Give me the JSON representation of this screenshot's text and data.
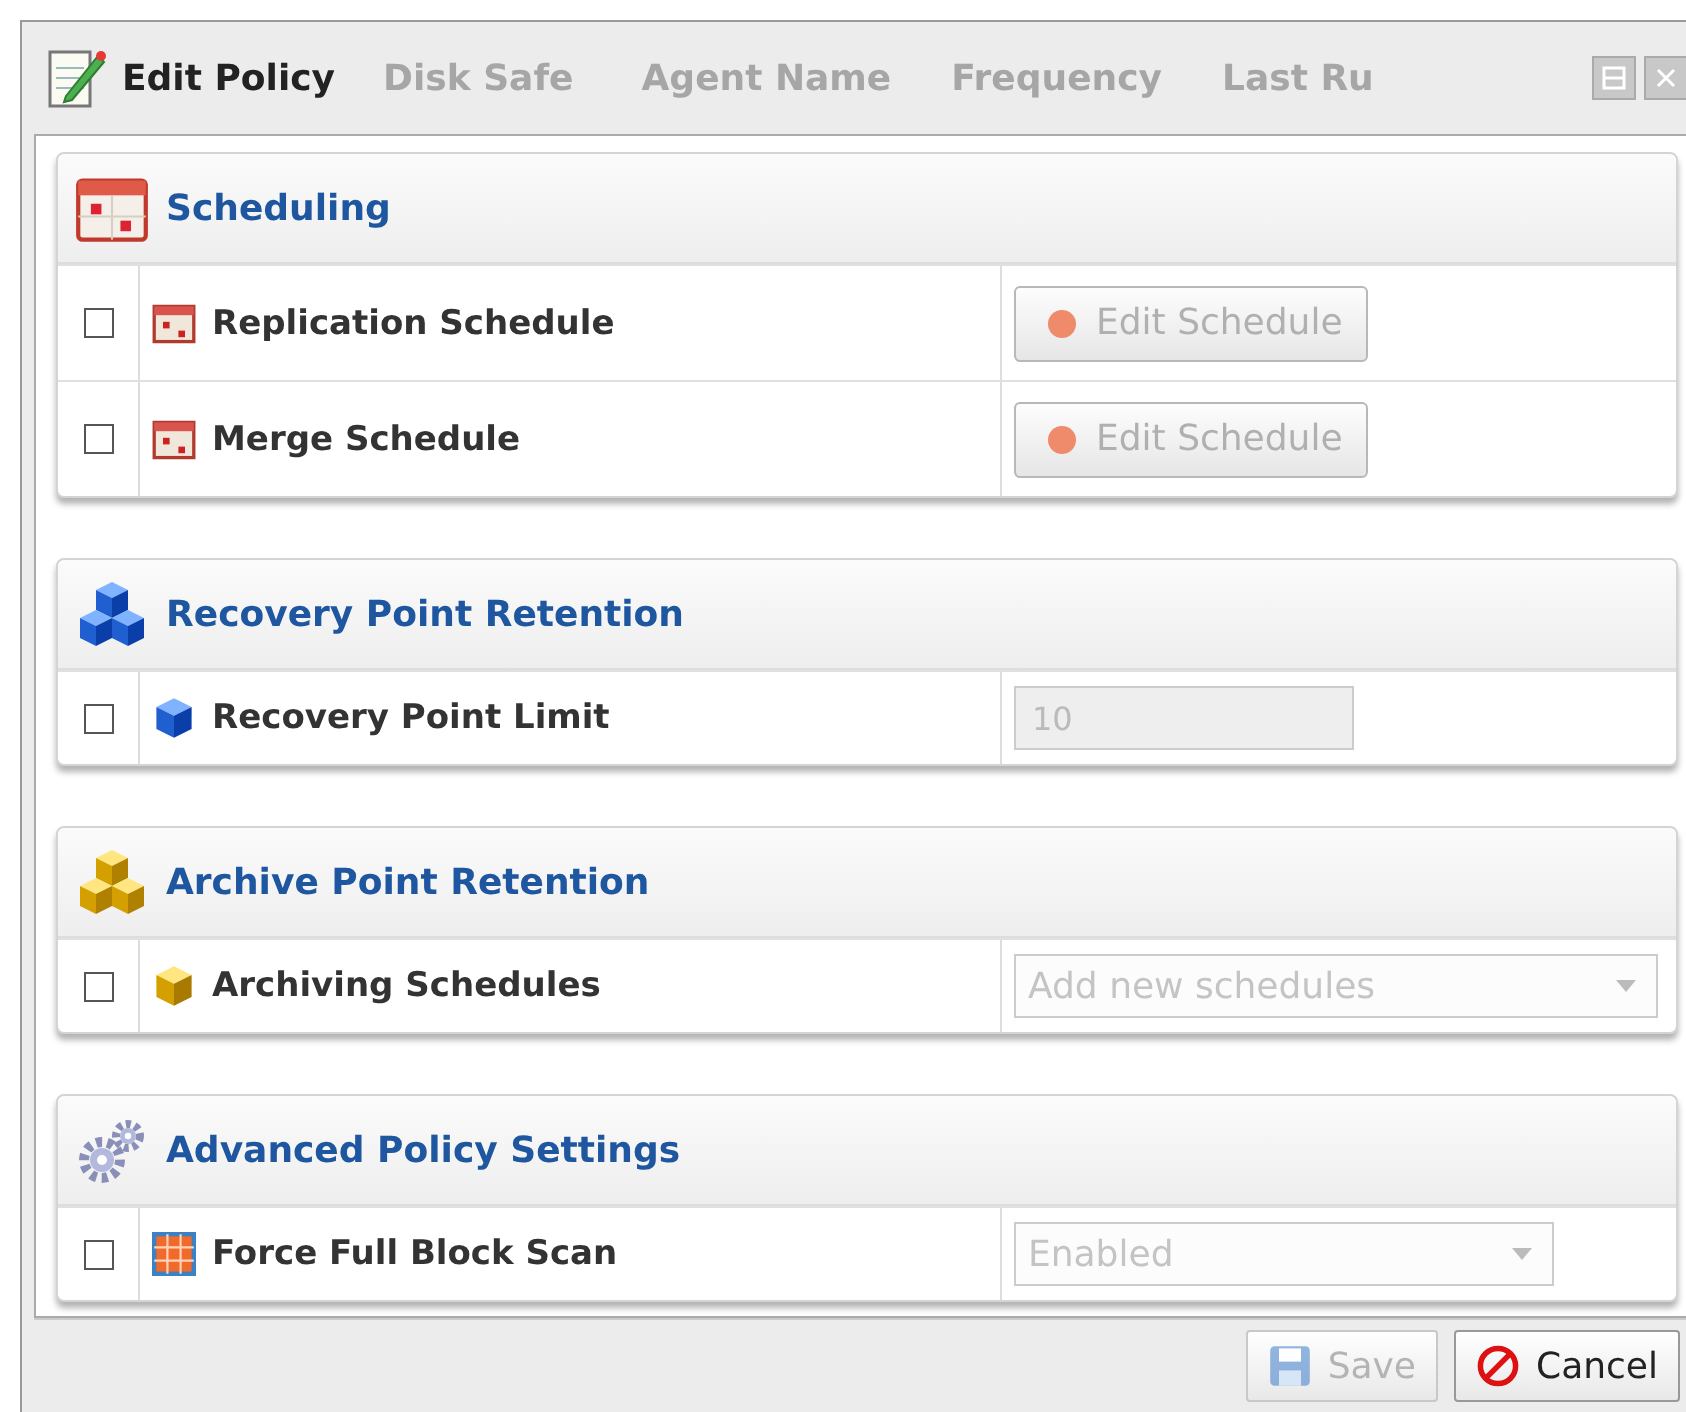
{
  "window": {
    "title": "Edit Policy"
  },
  "background_columns": [
    {
      "label": "Disk Safe"
    },
    {
      "label": "Agent Name"
    },
    {
      "label": "Frequency"
    },
    {
      "label": "Last Ru"
    }
  ],
  "sections": [
    {
      "title": "Scheduling",
      "rows": [
        {
          "label": "Replication Schedule",
          "checked": false,
          "control": {
            "kind": "button",
            "text": "Edit Schedule",
            "disabled": true
          }
        },
        {
          "label": "Merge Schedule",
          "checked": false,
          "control": {
            "kind": "button",
            "text": "Edit Schedule",
            "disabled": true
          }
        }
      ]
    },
    {
      "title": "Recovery Point Retention",
      "rows": [
        {
          "label": "Recovery Point Limit",
          "checked": false,
          "control": {
            "kind": "input",
            "value": "10",
            "disabled": true
          }
        }
      ]
    },
    {
      "title": "Archive Point Retention",
      "rows": [
        {
          "label": "Archiving Schedules",
          "checked": false,
          "control": {
            "kind": "select",
            "value": "Add new schedules",
            "disabled": true,
            "wide": true
          }
        }
      ]
    },
    {
      "title": "Advanced Policy Settings",
      "rows": [
        {
          "label": "Force Full Block Scan",
          "checked": false,
          "control": {
            "kind": "select",
            "value": "Enabled",
            "disabled": true,
            "wide": false
          }
        }
      ]
    }
  ],
  "buttons": [
    {
      "kind": "save",
      "label": "Save",
      "disabled": true
    },
    {
      "kind": "cancel",
      "label": "Cancel",
      "disabled": false
    }
  ]
}
